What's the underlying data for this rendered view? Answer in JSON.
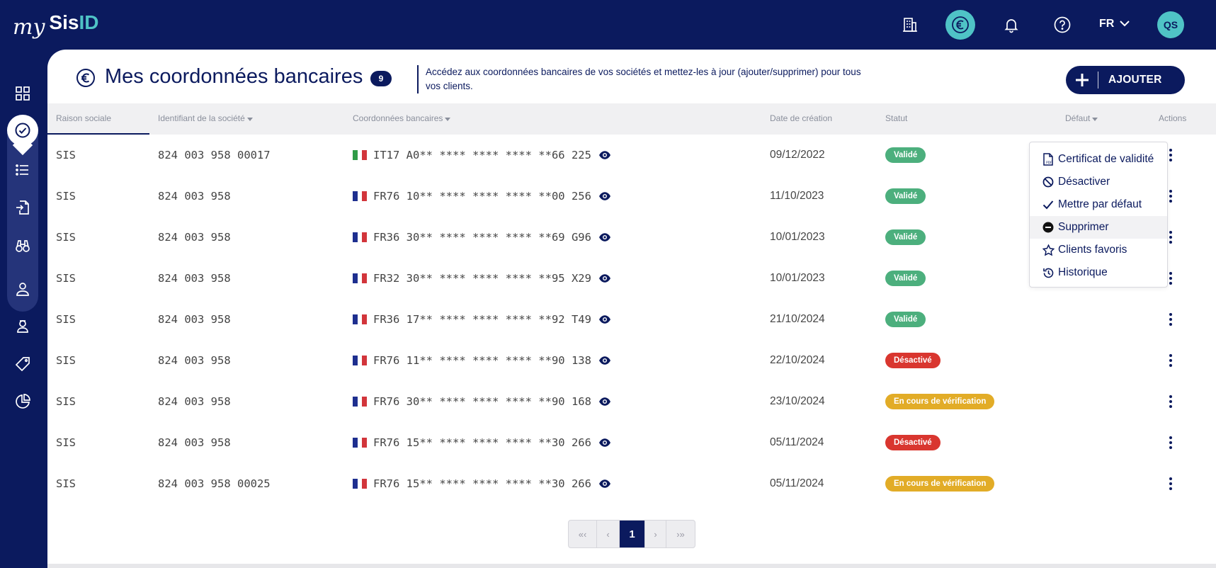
{
  "brand": {
    "my": "my",
    "sis": "Sis",
    "id": "ID"
  },
  "header": {
    "language": "FR",
    "avatar_initials": "QS",
    "icons": [
      "building-icon",
      "euro-icon",
      "bell-icon",
      "help-icon"
    ]
  },
  "page": {
    "title": "Mes coordonnées bancaires",
    "count": "9",
    "description": "Accédez aux coordonnées bancaires de vos sociétés et mettez-les à jour (ajouter/supprimer) pour tous vos clients.",
    "add_label": "AJOUTER"
  },
  "table": {
    "columns": {
      "raison": "Raison sociale",
      "identifiant": "Identifiant de la société",
      "coordonnees": "Coordonnées bancaires",
      "date": "Date de création",
      "statut": "Statut",
      "defaut": "Défaut",
      "actions": "Actions"
    },
    "rows": [
      {
        "raison": "SIS",
        "identifiant": "824 003 958 00017",
        "country": "IT",
        "iban": "IT17 A0** **** **** **** **66 225",
        "date": "09/12/2022",
        "statut": "Validé",
        "statut_color": "#4caf7d"
      },
      {
        "raison": "SIS",
        "identifiant": "824 003 958",
        "country": "FR",
        "iban": "FR76 10** **** **** **** **00 256",
        "date": "11/10/2023",
        "statut": "Validé",
        "statut_color": "#4caf7d"
      },
      {
        "raison": "SIS",
        "identifiant": "824 003 958",
        "country": "FR",
        "iban": "FR36 30** **** **** **** **69 G96",
        "date": "10/01/2023",
        "statut": "Validé",
        "statut_color": "#4caf7d"
      },
      {
        "raison": "SIS",
        "identifiant": "824 003 958",
        "country": "FR",
        "iban": "FR32 30** **** **** **** **95 X29",
        "date": "10/01/2023",
        "statut": "Validé",
        "statut_color": "#4caf7d"
      },
      {
        "raison": "SIS",
        "identifiant": "824 003 958",
        "country": "FR",
        "iban": "FR36 17** **** **** **** **92 T49",
        "date": "21/10/2024",
        "statut": "Validé",
        "statut_color": "#4caf7d"
      },
      {
        "raison": "SIS",
        "identifiant": "824 003 958",
        "country": "FR",
        "iban": "FR76 11** **** **** **** **90 138",
        "date": "22/10/2024",
        "statut": "Désactivé",
        "statut_color": "#d9362f"
      },
      {
        "raison": "SIS",
        "identifiant": "824 003 958",
        "country": "FR",
        "iban": "FR76 30** **** **** **** **90 168",
        "date": "23/10/2024",
        "statut": "En cours de vérification",
        "statut_color": "#e2ac27"
      },
      {
        "raison": "SIS",
        "identifiant": "824 003 958",
        "country": "FR",
        "iban": "FR76 15** **** **** **** **30 266",
        "date": "05/11/2024",
        "statut": "Désactivé",
        "statut_color": "#d9362f"
      },
      {
        "raison": "SIS",
        "identifiant": "824 003 958 00025",
        "country": "FR",
        "iban": "FR76 15** **** **** **** **30 266",
        "date": "05/11/2024",
        "statut": "En cours de vérification",
        "statut_color": "#e2ac27"
      }
    ]
  },
  "dropdown": {
    "items": [
      {
        "label": "Certificat de validité",
        "icon": "pdf-file-icon"
      },
      {
        "label": "Désactiver",
        "icon": "ban-icon"
      },
      {
        "label": "Mettre par défaut",
        "icon": "check-icon"
      },
      {
        "label": "Supprimer",
        "icon": "minus-circle-icon"
      },
      {
        "label": "Clients favoris",
        "icon": "star-icon"
      },
      {
        "label": "Historique",
        "icon": "history-icon"
      }
    ],
    "hovered_index": 3
  },
  "pagination": {
    "first": "«‹",
    "prev": "‹",
    "current": "1",
    "next": "›",
    "last": "›»"
  },
  "colors": {
    "navy": "#0b1a5e",
    "teal": "#4fc3c6",
    "valid": "#4caf7d",
    "disabled": "#d9362f",
    "pending": "#e2ac27"
  }
}
